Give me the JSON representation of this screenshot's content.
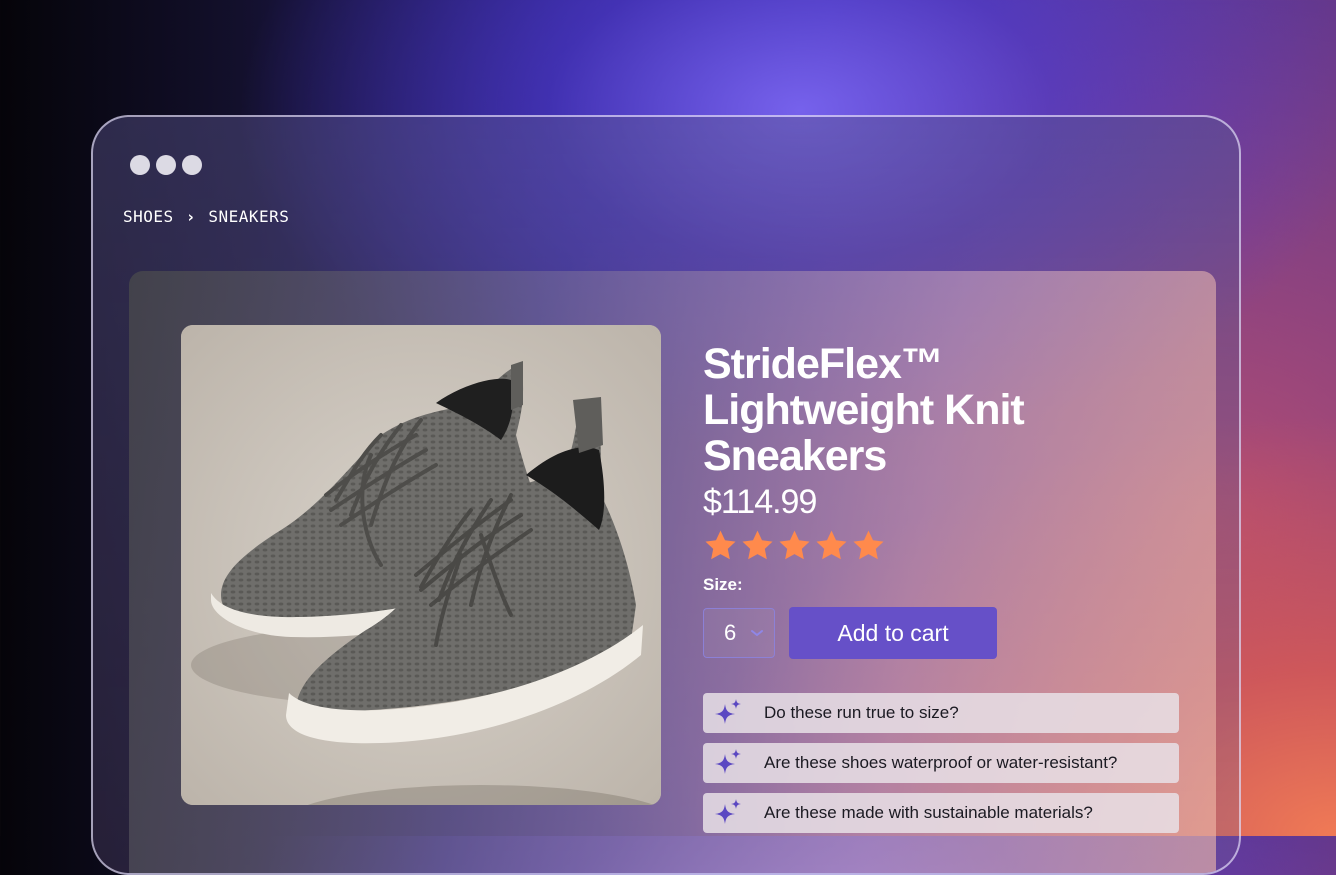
{
  "window": {
    "breadcrumb": [
      "SHOES",
      "SNEAKERS"
    ],
    "breadcrumb_separator": "›"
  },
  "product": {
    "image_name": "gray-knit-sneakers",
    "title": "StrideFlex™ Lightweight Knit Sneakers",
    "price": "$114.99",
    "rating": 5,
    "rating_max": 5,
    "size_label": "Size:",
    "size_value": "6",
    "add_to_cart": "Add to cart"
  },
  "questions": [
    "Do these run true to size?",
    "Are these shoes waterproof or water-resistant?",
    "Are these made with sustainable materials?"
  ],
  "colors": {
    "accent": "#6650c8",
    "star": "#ff8a4c",
    "sparkle": "#5b48c2"
  }
}
